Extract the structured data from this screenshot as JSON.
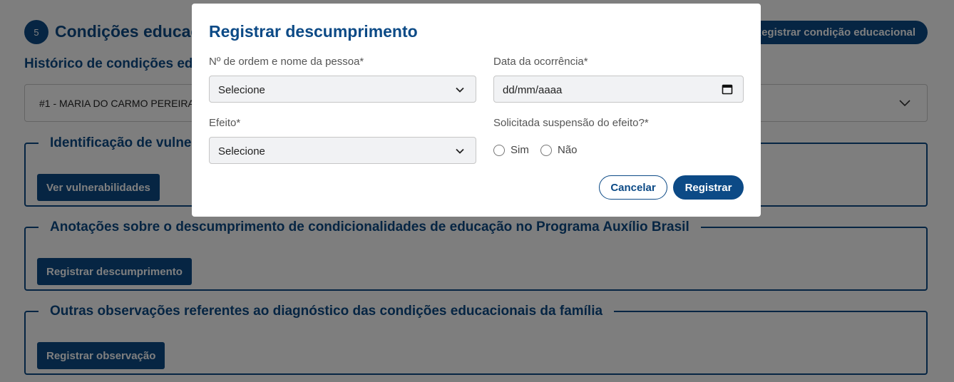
{
  "background": {
    "step_number": "5",
    "section_title": "Condições educacionais",
    "top_action_label": "Registrar condição educacional",
    "history_title": "Histórico de condições educacionais",
    "history_select_value": "#1 - MARIA DO CARMO PEREIRA",
    "box1": {
      "legend": "Identificação de vulnerabilidades",
      "button": "Ver vulnerabilidades"
    },
    "box2": {
      "legend": "Anotações sobre o descumprimento de condicionalidades de educação no Programa Auxílio Brasil",
      "button": "Registrar descumprimento"
    },
    "box3": {
      "legend": "Outras observações referentes ao diagnóstico das condições educacionais da família",
      "button": "Registrar observação"
    }
  },
  "modal": {
    "title": "Registrar descumprimento",
    "person_label": "Nº de ordem e nome da pessoa*",
    "person_value": "Selecione",
    "date_label": "Data da ocorrência*",
    "date_value": "dd/mm/aaaa",
    "effect_label": "Efeito*",
    "effect_value": "Selecione",
    "suspension_label": "Solicitada suspensão do efeito?*",
    "radio_yes": "Sim",
    "radio_no": "Não",
    "cancel_label": "Cancelar",
    "register_label": "Registrar"
  },
  "colors": {
    "brand": "#0c4a86",
    "overlay": "rgba(0,0,0,0.5)"
  }
}
